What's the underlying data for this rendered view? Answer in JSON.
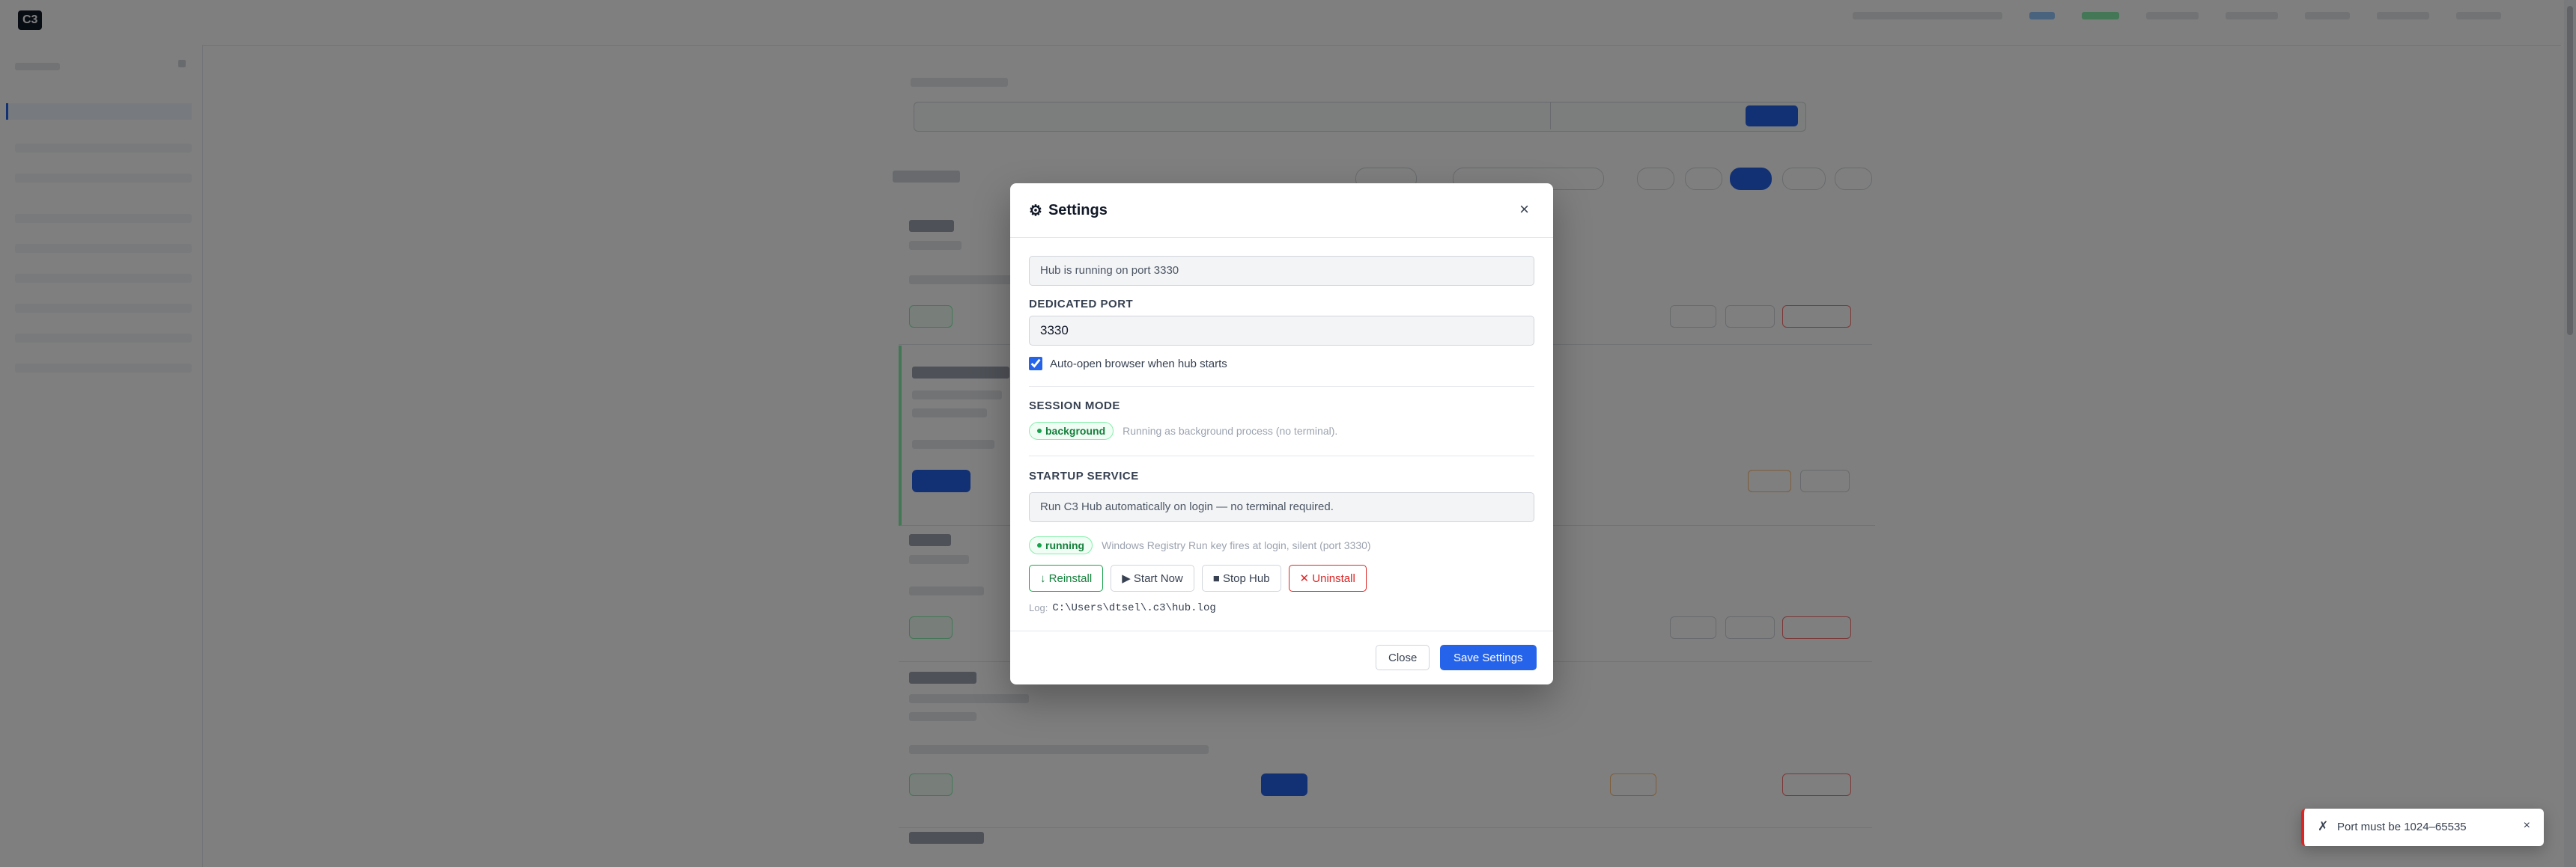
{
  "modal": {
    "title": "Settings",
    "close_icon": "×",
    "status_text": "Hub is running on port 3330",
    "port_label": "DEDICATED PORT",
    "port_value": "3330",
    "auto_open_label": "Auto-open browser when hub starts",
    "auto_open_checked": true,
    "session_mode_label": "SESSION MODE",
    "session_mode_badge": "background",
    "session_mode_hint": "Running as background process (no terminal).",
    "startup_label": "STARTUP SERVICE",
    "startup_desc": "Run C3 Hub automatically on login — no terminal required.",
    "startup_badge": "running",
    "startup_hint": "Windows Registry Run key fires at login, silent (port 3330)",
    "actions": {
      "reinstall": "↓ Reinstall",
      "start_now": "▶ Start Now",
      "stop_hub": "■ Stop Hub",
      "uninstall": "✕ Uninstall"
    },
    "log_prefix": "Log:",
    "log_path": "C:\\Users\\dtsel\\.c3\\hub.log",
    "footer": {
      "close": "Close",
      "save": "Save Settings"
    }
  },
  "toast": {
    "icon": "✗",
    "message": "Port must be 1024–65535",
    "close_icon": "×"
  },
  "colors": {
    "accent": "#2563eb",
    "success": "#16a34a",
    "danger": "#dc2626"
  }
}
